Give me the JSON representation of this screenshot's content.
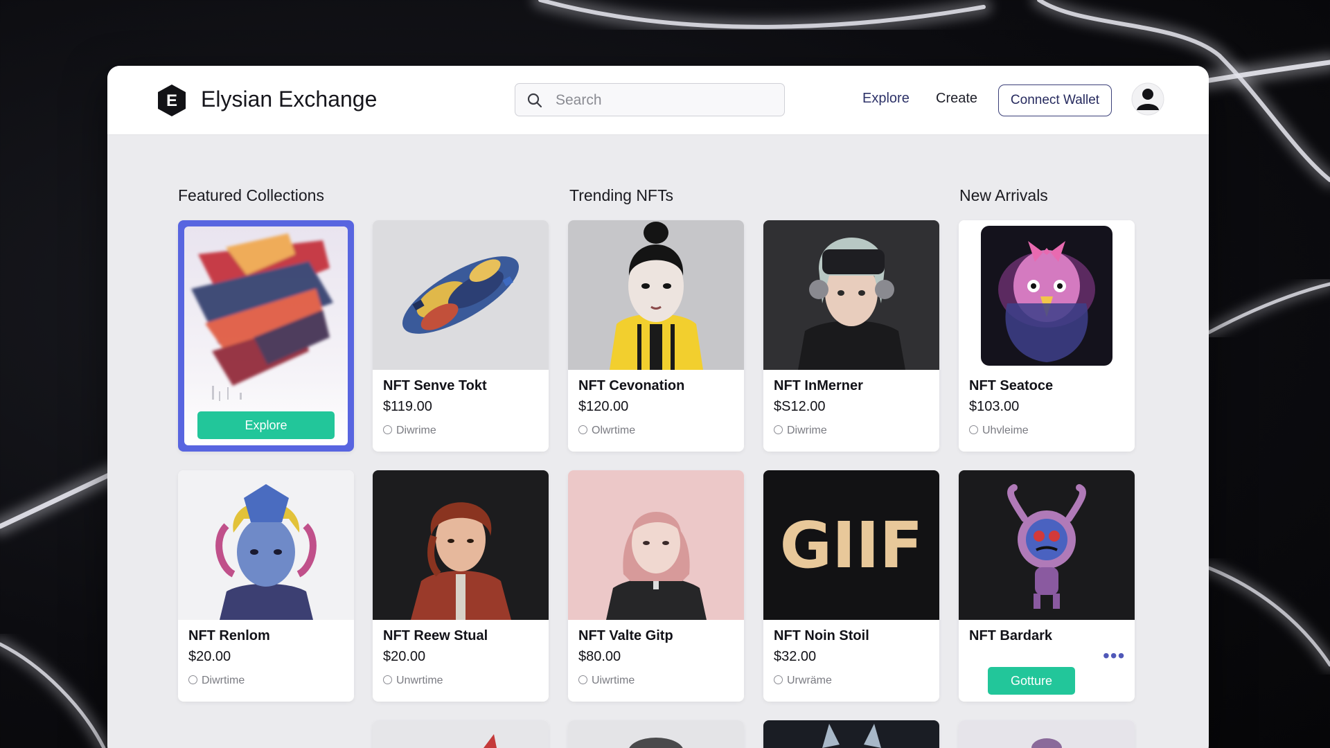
{
  "app": {
    "brand": "Elysian Exchange",
    "logo_letter": "E"
  },
  "search": {
    "placeholder": "Search"
  },
  "nav": {
    "explore": "Explore",
    "create": "Create",
    "connect_wallet": "Connect Wallet"
  },
  "sections": {
    "featured": "Featured Collections",
    "trending": "Trending NFTs",
    "new_arrivals": "New Arrivals"
  },
  "featured_card": {
    "button": "Explore"
  },
  "cards_row1": [
    {
      "name": "NFT Senve Tokt",
      "price": "$119.00",
      "meta": "Diwrime"
    },
    {
      "name": "NFT Cevonation",
      "price": "$120.00",
      "meta": "Olwrtime"
    },
    {
      "name": "NFT InMerner",
      "price": "$S12.00",
      "meta": "Diwrime"
    },
    {
      "name": "NFT Seatoce",
      "price": "$103.00",
      "meta": "Uhvleime"
    }
  ],
  "cards_row2": [
    {
      "name": "NFT Renlom",
      "price": "$20.00",
      "meta": "Diwrtime"
    },
    {
      "name": "NFT Reew Stual",
      "price": "$20.00",
      "meta": "Unwrtime"
    },
    {
      "name": "NFT Valte Gitp",
      "price": "$80.00",
      "meta": "Uiwrtime"
    },
    {
      "name": "NFT Noin Stoil",
      "price": "$32.00",
      "meta": "Urwräme"
    },
    {
      "name": "NFT Bardark",
      "button": "Gotture"
    }
  ],
  "gif_text": "GIIF",
  "colors": {
    "accent_green": "#22c69a",
    "featured_border": "#5865e0",
    "nav_text": "#2d3268"
  }
}
